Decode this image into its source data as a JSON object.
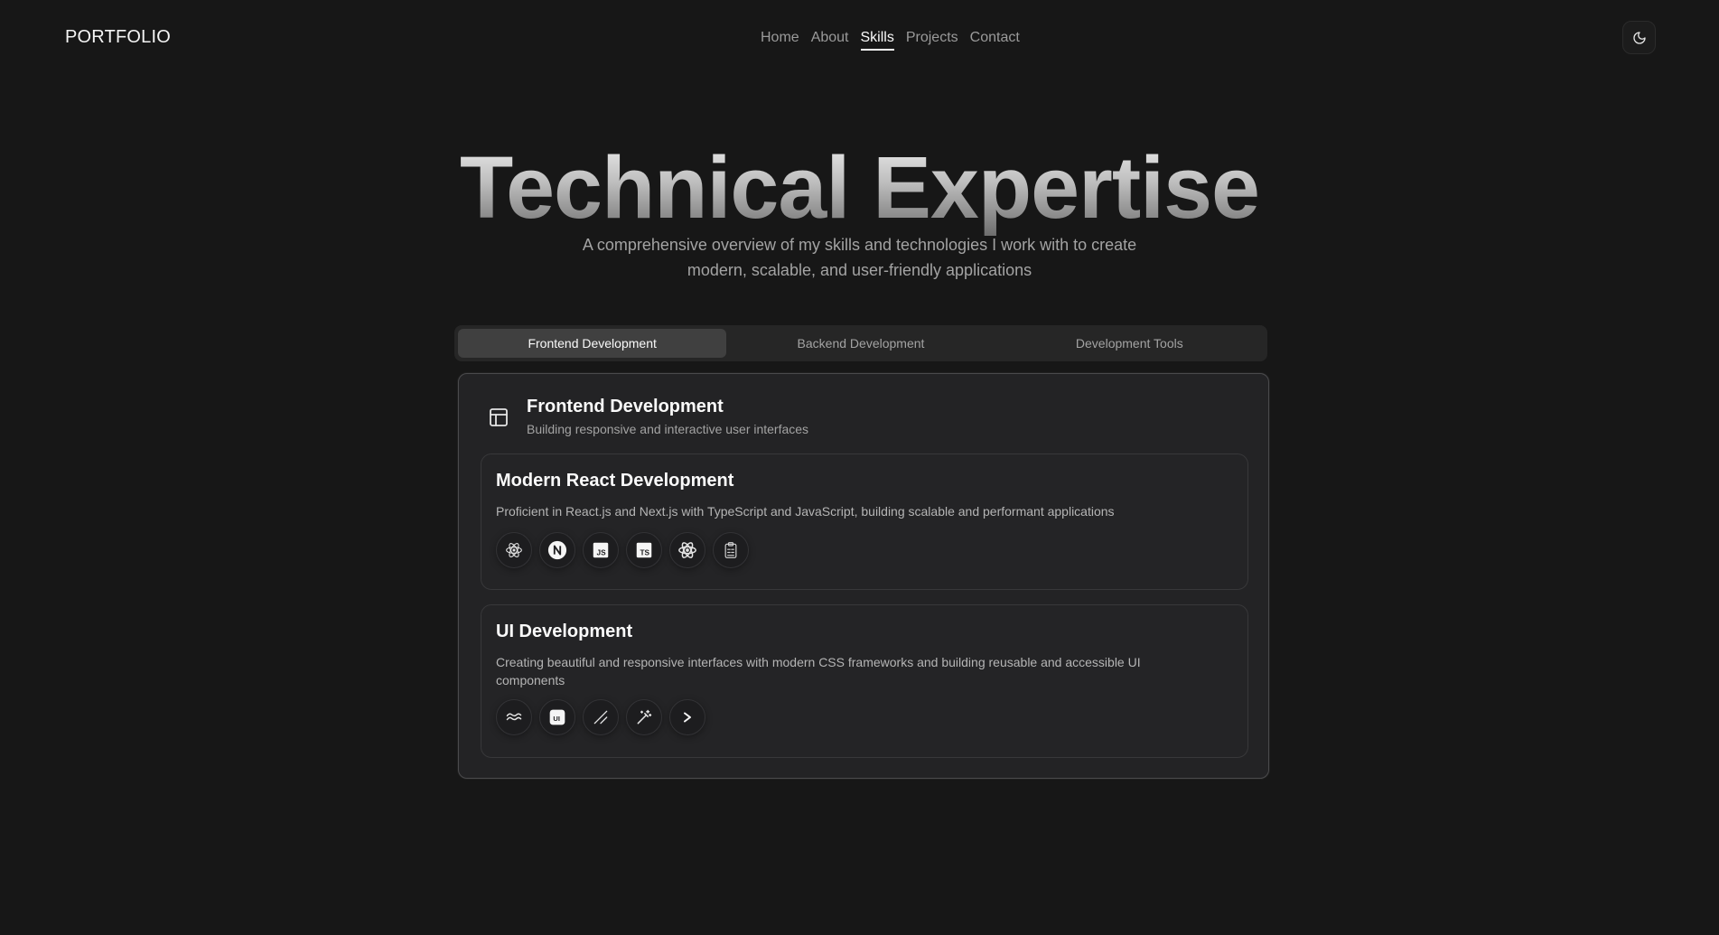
{
  "brand": "PORTFOLIO",
  "nav": {
    "items": [
      {
        "label": "Home",
        "active": false
      },
      {
        "label": "About",
        "active": false
      },
      {
        "label": "Skills",
        "active": true
      },
      {
        "label": "Projects",
        "active": false
      },
      {
        "label": "Contact",
        "active": false
      }
    ]
  },
  "theme_toggle": {
    "icon": "moon-icon"
  },
  "hero": {
    "title": "Technical Expertise",
    "subtitle": "A comprehensive overview of my skills and technologies I work with to create modern, scalable, and user-friendly applications"
  },
  "tabs": [
    {
      "label": "Frontend Development",
      "active": true
    },
    {
      "label": "Backend Development",
      "active": false
    },
    {
      "label": "Development Tools",
      "active": false
    }
  ],
  "panel": {
    "icon": "layout-panel-icon",
    "title": "Frontend Development",
    "description": "Building responsive and interactive user interfaces",
    "skills": [
      {
        "title": "Modern React Development",
        "description": "Proficient in React.js and Next.js with TypeScript and JavaScript, building scalable and performant applications",
        "icons": [
          "react-icon",
          "nextjs-icon",
          "javascript-icon",
          "typescript-icon",
          "react-native-icon",
          "clipboard-icon"
        ]
      },
      {
        "title": "UI Development",
        "description": "Creating beautiful and responsive interfaces with modern CSS frameworks and building reusable and accessible UI components",
        "icons": [
          "tailwind-icon",
          "material-ui-icon",
          "shadcn-icon",
          "magic-wand-icon",
          "chevron-right-icon"
        ]
      }
    ]
  },
  "colors": {
    "background": "#171717",
    "card": "#232325",
    "tab_active": "#404040",
    "text_primary": "#fafafa",
    "text_muted": "#a3a3a3"
  }
}
